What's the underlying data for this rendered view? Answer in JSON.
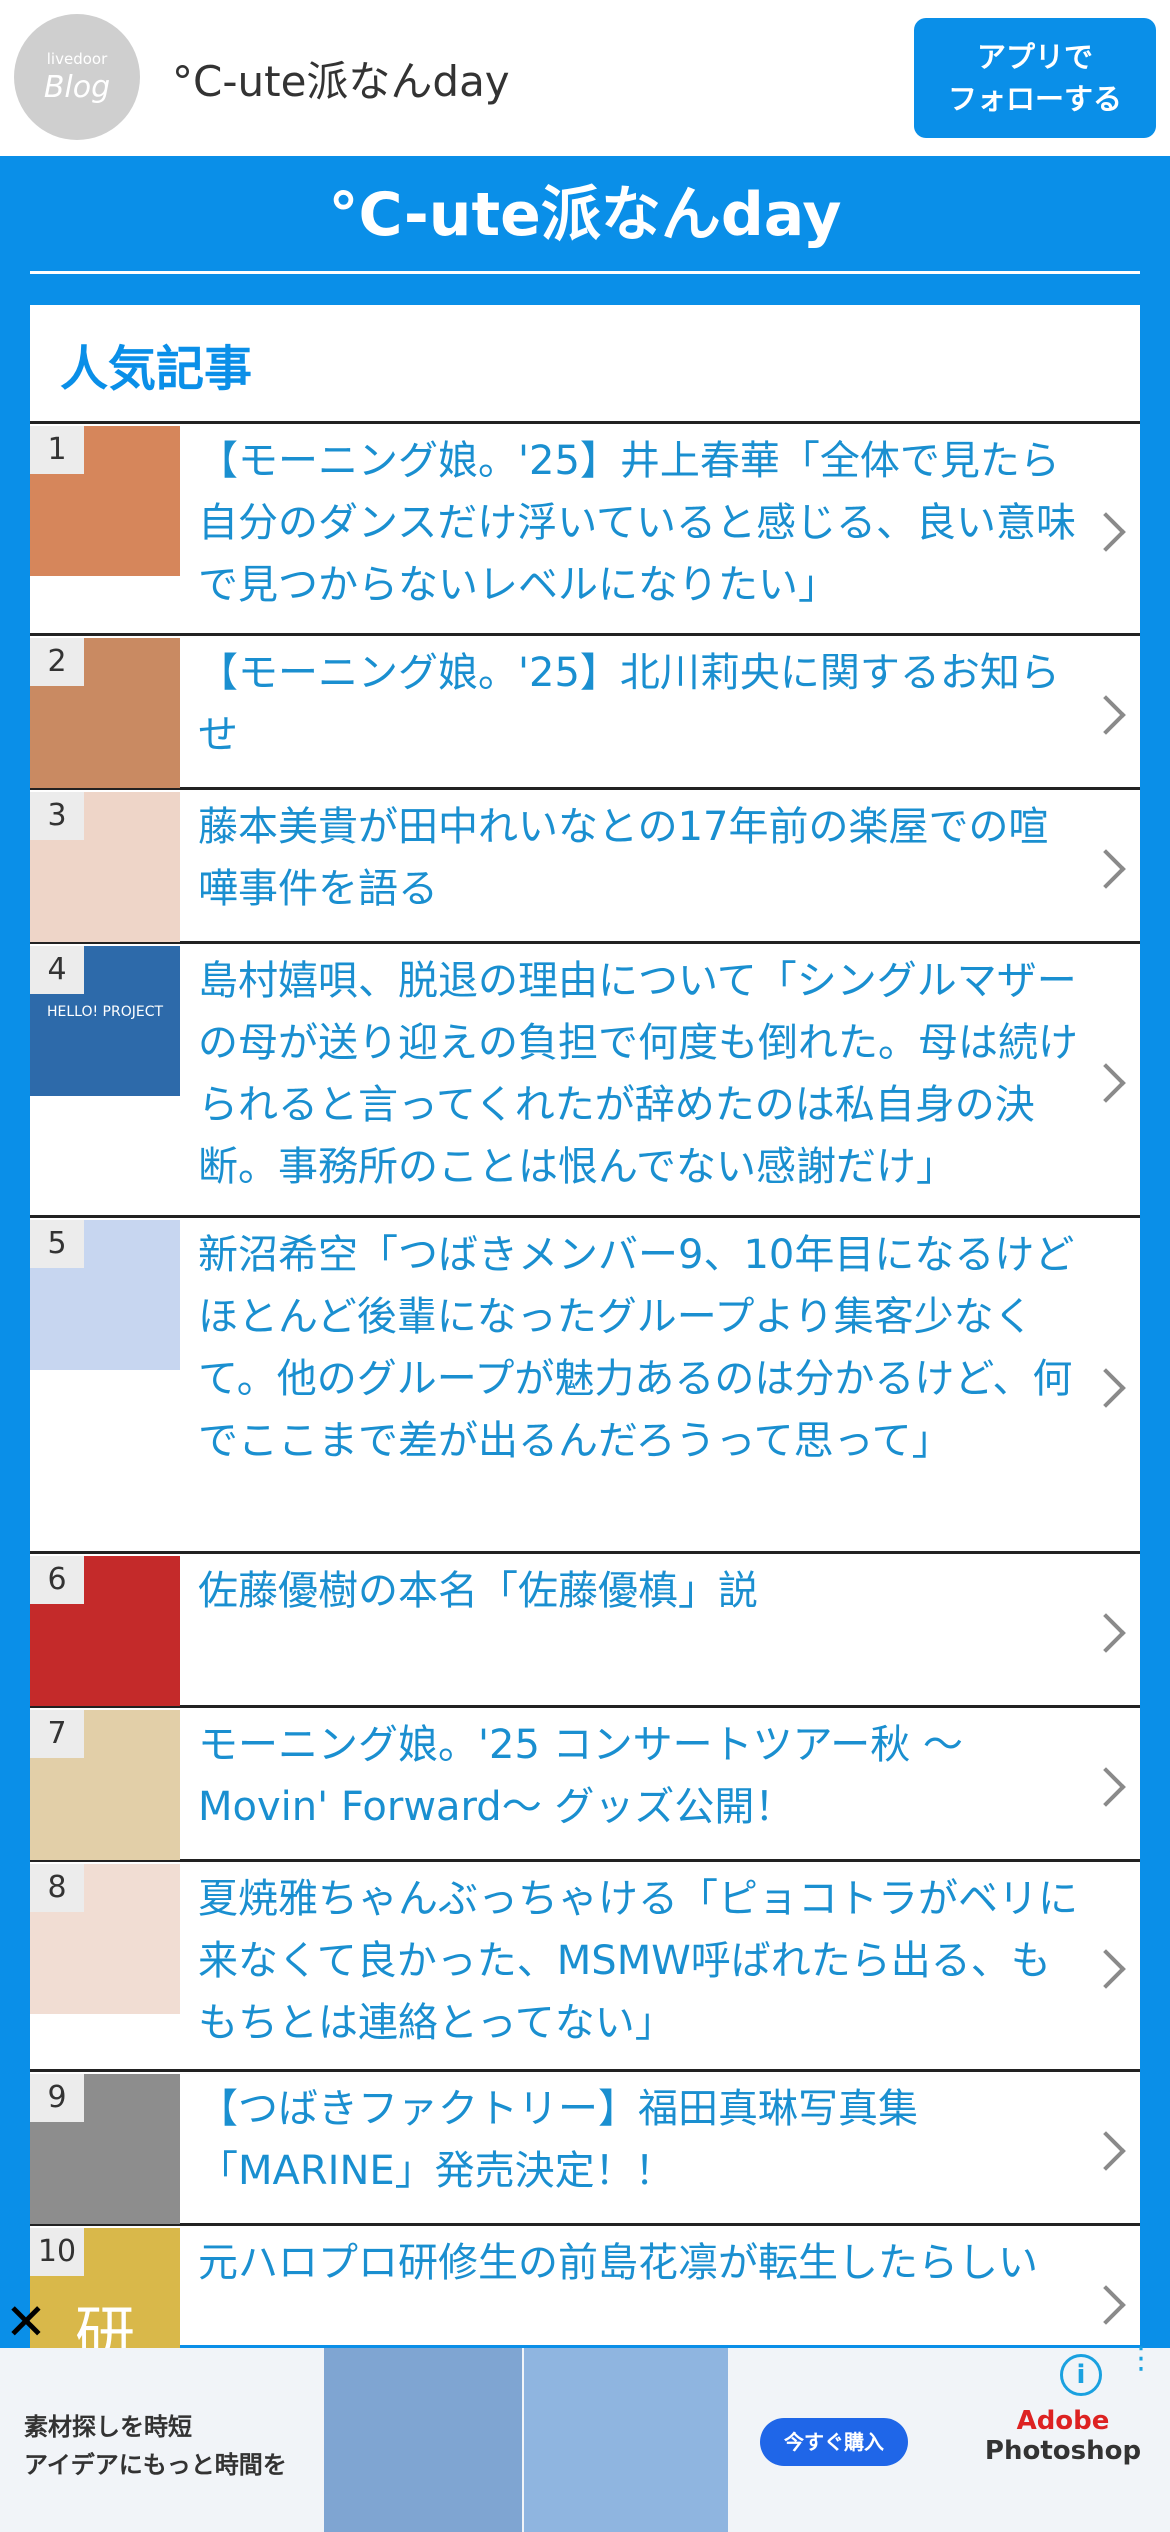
{
  "header": {
    "logo_small": "livedoor",
    "logo_big": "Blog",
    "site_title": "°C-ute派なんday",
    "follow_line1": "アプリで",
    "follow_line2": "フォローする"
  },
  "banner": {
    "title": "°C-ute派なんday"
  },
  "popular": {
    "heading": "人気記事",
    "items": [
      {
        "rank": "1",
        "title": "【モーニング娘。'25】井上春華「全体で見たら自分のダンスだけ浮いていると感じる、良い意味で見つからないレベルになりたい」",
        "thumb_color": "#d6865b"
      },
      {
        "rank": "2",
        "title": "【モーニング娘。'25】北川莉央に関するお知らせ",
        "thumb_color": "#c98a62"
      },
      {
        "rank": "3",
        "title": "藤本美貴が田中れいなとの17年前の楽屋での喧嘩事件を語る",
        "thumb_color": "#eed5c8"
      },
      {
        "rank": "4",
        "title": "島村嬉唄、脱退の理由について「シングルマザーの母が送り迎えの負担で何度も倒れた。母は続けられると言ってくれたが辞めたのは私自身の決断。事務所のことは恨んでない感謝だけ」",
        "thumb_color": "#2d6aaa",
        "thumb_text": "HELLO! PROJECT"
      },
      {
        "rank": "5",
        "title": "新沼希空「つばきメンバー9、10年目になるけどほとんど後輩になったグループより集客少なくて。他のグループが魅力あるのは分かるけど、何でここまで差が出るんだろうって思って」",
        "thumb_color": "#c7d6f0"
      },
      {
        "rank": "6",
        "title": "佐藤優樹の本名「佐藤優槙」説",
        "thumb_color": "#c42a2a"
      },
      {
        "rank": "7",
        "title": "モーニング娘。'25 コンサートツアー秋 〜Movin' Forward〜 グッズ公開！",
        "thumb_color": "#e2cfa8"
      },
      {
        "rank": "8",
        "title": "夏焼雅ちゃんぶっちゃける「ピョコトラがベリに来なくて良かった、MSMW呼ばれたら出る、ももちとは連絡とってない」",
        "thumb_color": "#f1ddd3"
      },
      {
        "rank": "9",
        "title": "【つばきファクトリー】福田真琳写真集「MARINE」発売決定！！",
        "thumb_color": "#8d8d8d"
      },
      {
        "rank": "10",
        "title": "元ハロプロ研修生の前島花凛が転生したらしい",
        "thumb_color": "#d9b84a",
        "thumb_text": "研"
      }
    ]
  },
  "ad": {
    "close_label": "✕",
    "line1": "素材探しを時短",
    "line2": "アイデアにもっと時間を",
    "button_label": "今すぐ購入",
    "brand_line1": "Adobe",
    "brand_line2": "Photoshop",
    "info_label": "i",
    "menu_label": "⋮"
  }
}
